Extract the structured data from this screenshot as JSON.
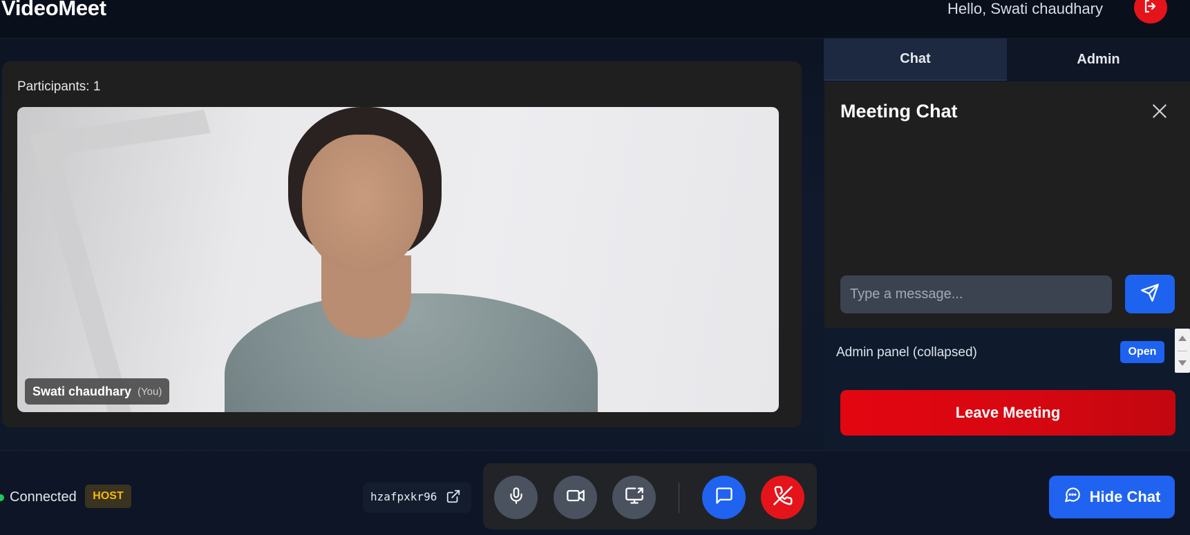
{
  "app": {
    "title": "VideoMeet",
    "greeting": "Hello, Swati chaudhary"
  },
  "video": {
    "participants_label": "Participants: 1",
    "tile": {
      "name": "Swati chaudhary",
      "you_label": "(You)"
    }
  },
  "sidebar": {
    "tabs": [
      {
        "label": "Chat",
        "active": true
      },
      {
        "label": "Admin",
        "active": false
      }
    ],
    "chat": {
      "title": "Meeting Chat",
      "input_placeholder": "Type a message..."
    },
    "admin": {
      "label": "Admin panel (collapsed)",
      "open_label": "Open"
    },
    "leave_label": "Leave Meeting"
  },
  "bottom": {
    "status": "Connected",
    "role_badge": "HOST",
    "meeting_code": "hzafpxkr96",
    "hide_chat_label": "Hide Chat"
  },
  "colors": {
    "accent_blue": "#1f63f0",
    "danger_red": "#e5141b",
    "host_gold": "#f5b90b",
    "connected_green": "#22c55e"
  },
  "icons": [
    "logout-icon",
    "close-icon",
    "send-icon",
    "external-link-icon",
    "microphone-icon",
    "video-camera-icon",
    "screen-share-icon",
    "chat-bubble-icon",
    "hang-up-icon"
  ]
}
